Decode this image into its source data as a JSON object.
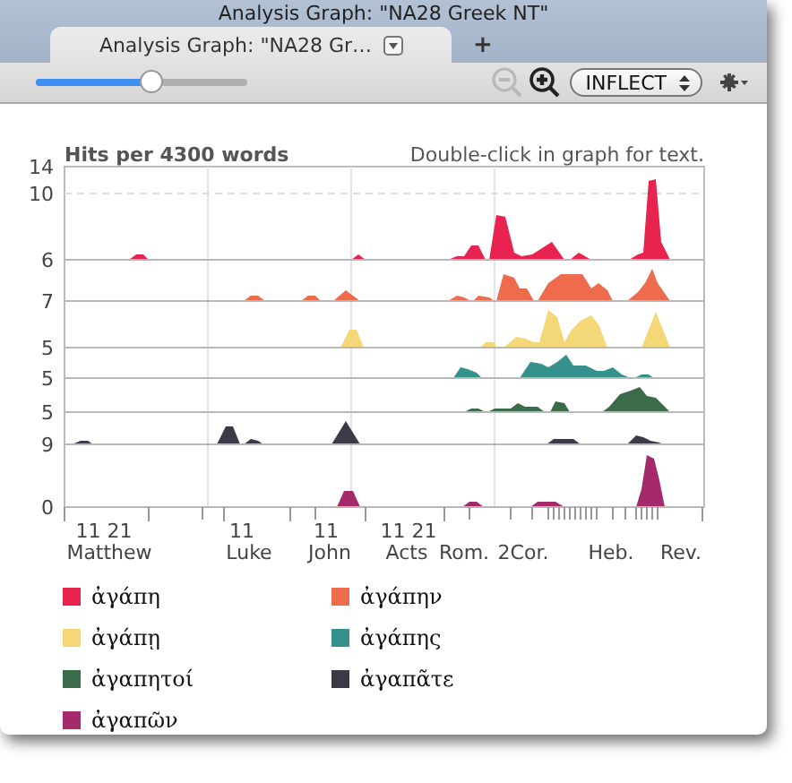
{
  "window": {
    "title": "Analysis Graph: \"NA28 Greek NT\""
  },
  "tabs": [
    {
      "label": "Analysis Graph: \"NA28 Gr…",
      "selected": true
    }
  ],
  "new_tab_button": "+",
  "toolbar": {
    "zoom_slider": {
      "level": 0.55
    },
    "zoom_out": {
      "disabled": true
    },
    "zoom_in": {
      "disabled": false
    },
    "mode_popup": {
      "value": "INFLECT"
    }
  },
  "graph": {
    "ylabel": "Hits per 4300 words",
    "hint": "Double-click in graph for text.",
    "y_labels": [
      "14",
      "10",
      "6",
      "7",
      "5",
      "5",
      "5",
      "9",
      "0"
    ],
    "x_numbers": [
      "11 21",
      "11",
      "11",
      "11 21"
    ],
    "x_books": [
      "Matthew",
      "Luke",
      "John",
      "Acts",
      "Rom.",
      "2Cor.",
      "Heb.",
      "Rev."
    ]
  },
  "legend": [
    {
      "label": "ἀγάπη",
      "color": "#e8234f"
    },
    {
      "label": "ἀγάπην",
      "color": "#ee6b4e"
    },
    {
      "label": "ἀγάπῃ",
      "color": "#f4d878"
    },
    {
      "label": "ἀγάπης",
      "color": "#36918d"
    },
    {
      "label": "ἀγαπητοί",
      "color": "#3b6b48"
    },
    {
      "label": "ἀγαπᾶτε",
      "color": "#3a3b46"
    },
    {
      "label": "ἀγαπῶν",
      "color": "#a42a6c"
    }
  ]
}
